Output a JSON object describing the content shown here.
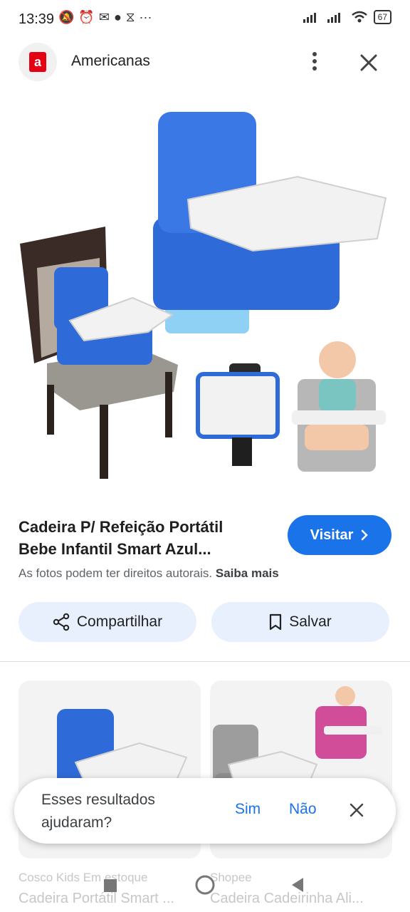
{
  "status": {
    "time": "13:39",
    "battery": "67",
    "overflow": "···"
  },
  "header": {
    "site_name": "Americanas",
    "logo_letter": "a"
  },
  "product": {
    "title_line1": "Cadeira P/ Refeição Portátil",
    "title_line2": "Bebe Infantil Smart Azul...",
    "visit_label": "Visitar",
    "copyright_text": "As fotos podem ter direitos autorais.",
    "learn_more": "Saiba mais"
  },
  "actions": {
    "share_label": "Compartilhar",
    "save_label": "Salvar"
  },
  "related": [
    {
      "source": "Cosco Kids",
      "stock": "Em estoque",
      "title": "Cadeira Portátil Smart ..."
    },
    {
      "source": "Shopee",
      "title": "Cadeira Cadeirinha Ali..."
    }
  ],
  "feedback": {
    "question": "Esses resultados ajudaram?",
    "yes": "Sim",
    "no": "Não"
  },
  "colors": {
    "accent": "#1a73e8",
    "pill_bg": "#e8f0fe",
    "brand_red": "#e60014",
    "chair_blue": "#2f6bd8"
  },
  "icons": [
    "more-vert-icon",
    "close-icon",
    "share-icon",
    "bookmark-icon",
    "chevron-right-icon",
    "home-nav-icon",
    "back-nav-icon",
    "recents-nav-icon"
  ]
}
